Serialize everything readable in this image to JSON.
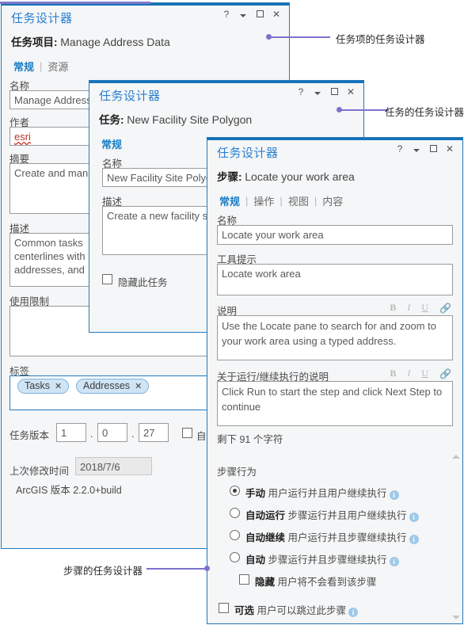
{
  "colors": {
    "accent_blue": "#1572b8",
    "title_blue": "#2a7fd0",
    "callout_purple": "#7b72cf",
    "tag_blue": "#cfe4f5"
  },
  "window_controls": {
    "help": "?",
    "menu": "menu-caret",
    "maximize": "maximize",
    "close": "✕"
  },
  "taskitem_window": {
    "title": "任务设计器",
    "subject_label": "任务项目:",
    "subject_value": "Manage Address Data",
    "tabs": [
      {
        "label": "常规",
        "active": true
      },
      {
        "label": "资源",
        "active": false
      }
    ],
    "fields": {
      "name_label": "名称",
      "name_value": "Manage Address",
      "author_label": "作者",
      "author_value": "esri",
      "summary_label": "摘要",
      "summary_value": "Create and mana",
      "description_label": "描述",
      "description_value": "Common tasks\ncenterlines with\naddresses, and",
      "usage_label": "使用限制",
      "usage_value": "",
      "tags_label": "标签",
      "tags": [
        "Tasks",
        "Addresses"
      ],
      "tag_remove": "✕",
      "version_label": "任务版本",
      "version_major": "1",
      "version_minor": "0",
      "version_build": "27",
      "version_dot": ".",
      "auto_checkbox_label": "自",
      "modified_label": "上次修改时间",
      "modified_value": "2018/7/6",
      "arcgis_version": "ArcGIS 版本 2.2.0+build"
    }
  },
  "task_window": {
    "title": "任务设计器",
    "subject_label": "任务:",
    "subject_value": "New Facility Site Polygon",
    "tabs": [
      {
        "label": "常规",
        "active": true
      }
    ],
    "fields": {
      "name_label": "名称",
      "name_value": "New Facility Site Polygo",
      "description_label": "描述",
      "description_value": "Create a new facility s",
      "hide_task_label": "隐藏此任务"
    }
  },
  "step_window": {
    "title": "任务设计器",
    "subject_label": "步骤:",
    "subject_value": "Locate your work area",
    "tabs": [
      {
        "label": "常规",
        "active": true
      },
      {
        "label": "操作",
        "active": false
      },
      {
        "label": "视图",
        "active": false
      },
      {
        "label": "内容",
        "active": false
      }
    ],
    "fields": {
      "name_label": "名称",
      "name_value": "Locate your work area",
      "tooltip_label": "工具提示",
      "tooltip_value": "Locate work area",
      "instructions_label": "说明",
      "instructions_value": "Use the Locate pane to search for and zoom to your work area using a typed address.",
      "run_instructions_label": "关于运行/继续执行的说明",
      "run_instructions_value": "Click Run to start the step and click Next Step to continue",
      "chars_remaining": "剩下 91 个字符"
    },
    "rich_toolbar": {
      "bold": "B",
      "italic": "I",
      "underline": "U",
      "link": "link-icon"
    },
    "step_behavior": {
      "heading": "步骤行为",
      "options": [
        {
          "name": "手动",
          "desc": "用户运行并且用户继续执行",
          "selected": true
        },
        {
          "name": "自动运行",
          "desc": "步骤运行并且用户继续执行",
          "selected": false
        },
        {
          "name": "自动继续",
          "desc": "用户运行并且步骤继续执行",
          "selected": false
        },
        {
          "name": "自动",
          "desc": "步骤运行并且步骤继续执行",
          "selected": false
        }
      ],
      "hidden_checkbox": {
        "name": "隐藏",
        "desc": "用户将不会看到该步骤",
        "checked": false
      },
      "optional_checkbox": {
        "name": "可选",
        "desc": "用户可以跳过此步骤",
        "checked": false
      }
    }
  },
  "callouts": [
    {
      "text": "任务项的任务设计器"
    },
    {
      "text": "任务的任务设计器"
    },
    {
      "text": "步骤的任务设计器"
    }
  ]
}
